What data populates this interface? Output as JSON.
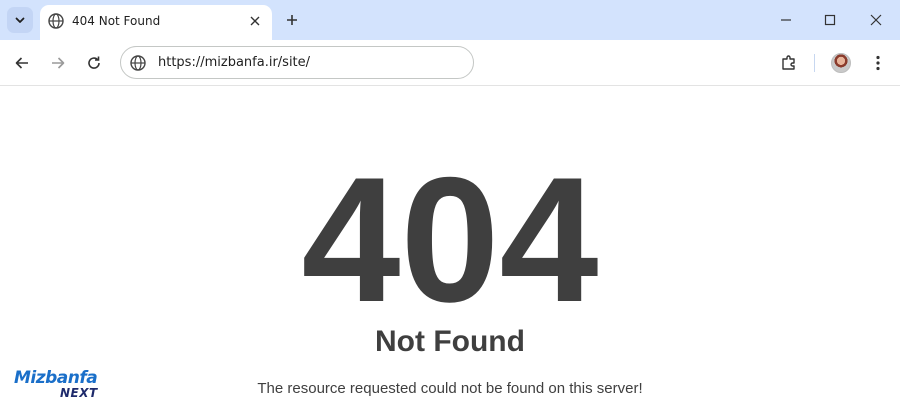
{
  "browser": {
    "tab": {
      "title": "404 Not Found"
    },
    "address": {
      "url": "https://mizbanfa.ir/site/"
    }
  },
  "page": {
    "code": "404",
    "heading": "Not Found",
    "message": "The resource requested could not be found on this server!"
  },
  "watermark": {
    "brand": "Mizbanfa",
    "sub": "NEXT"
  },
  "icons": [
    "tab-search-icon",
    "globe-icon",
    "close-icon",
    "plus-icon",
    "minimize-icon",
    "maximize-icon",
    "close-window-icon",
    "back-arrow-icon",
    "forward-arrow-icon",
    "reload-icon",
    "extensions-icon",
    "kebab-menu-icon"
  ],
  "colors": {
    "titlebar": "#d3e3fd",
    "text": "#3f3f3f",
    "brand": "#1a6fc9"
  }
}
